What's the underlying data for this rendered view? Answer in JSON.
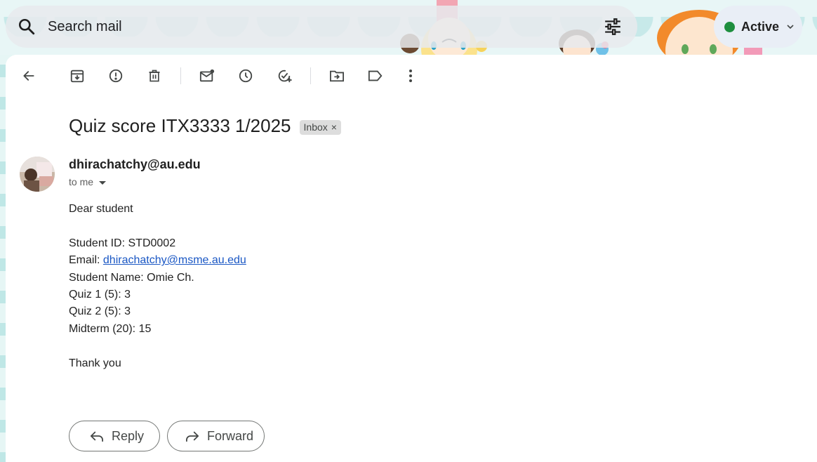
{
  "search": {
    "placeholder": "Search mail"
  },
  "status": {
    "label": "Active",
    "dot_color": "#1e8e3e"
  },
  "toolbar": {
    "icons": [
      "back-arrow-icon",
      "archive-icon",
      "report-spam-icon",
      "delete-icon",
      "mark-unread-icon",
      "snooze-icon",
      "add-task-icon",
      "move-to-icon",
      "label-icon",
      "more-options-icon"
    ]
  },
  "email": {
    "subject": "Quiz score ITX3333 1/2025",
    "label": "Inbox",
    "label_remove": "×",
    "sender": "dhirachatchy@au.edu",
    "recipient": "to me",
    "greeting": "Dear student",
    "student_id": "Student ID: STD0002",
    "email_prefix": "Email: ",
    "email_link": "dhirachatchy@msme.au.edu",
    "student_name": "Student Name: Omie Ch.",
    "quiz1": "Quiz 1 (5): 3",
    "quiz2": "Quiz 2 (5): 3",
    "midterm": "Midterm (20): 15",
    "closing": "Thank you"
  },
  "actions": {
    "reply": "Reply",
    "forward": "Forward"
  },
  "colors": {
    "link": "#1a57c4",
    "chip_bg": "#dddddd",
    "active_chip_bg": "#e9eef6"
  }
}
